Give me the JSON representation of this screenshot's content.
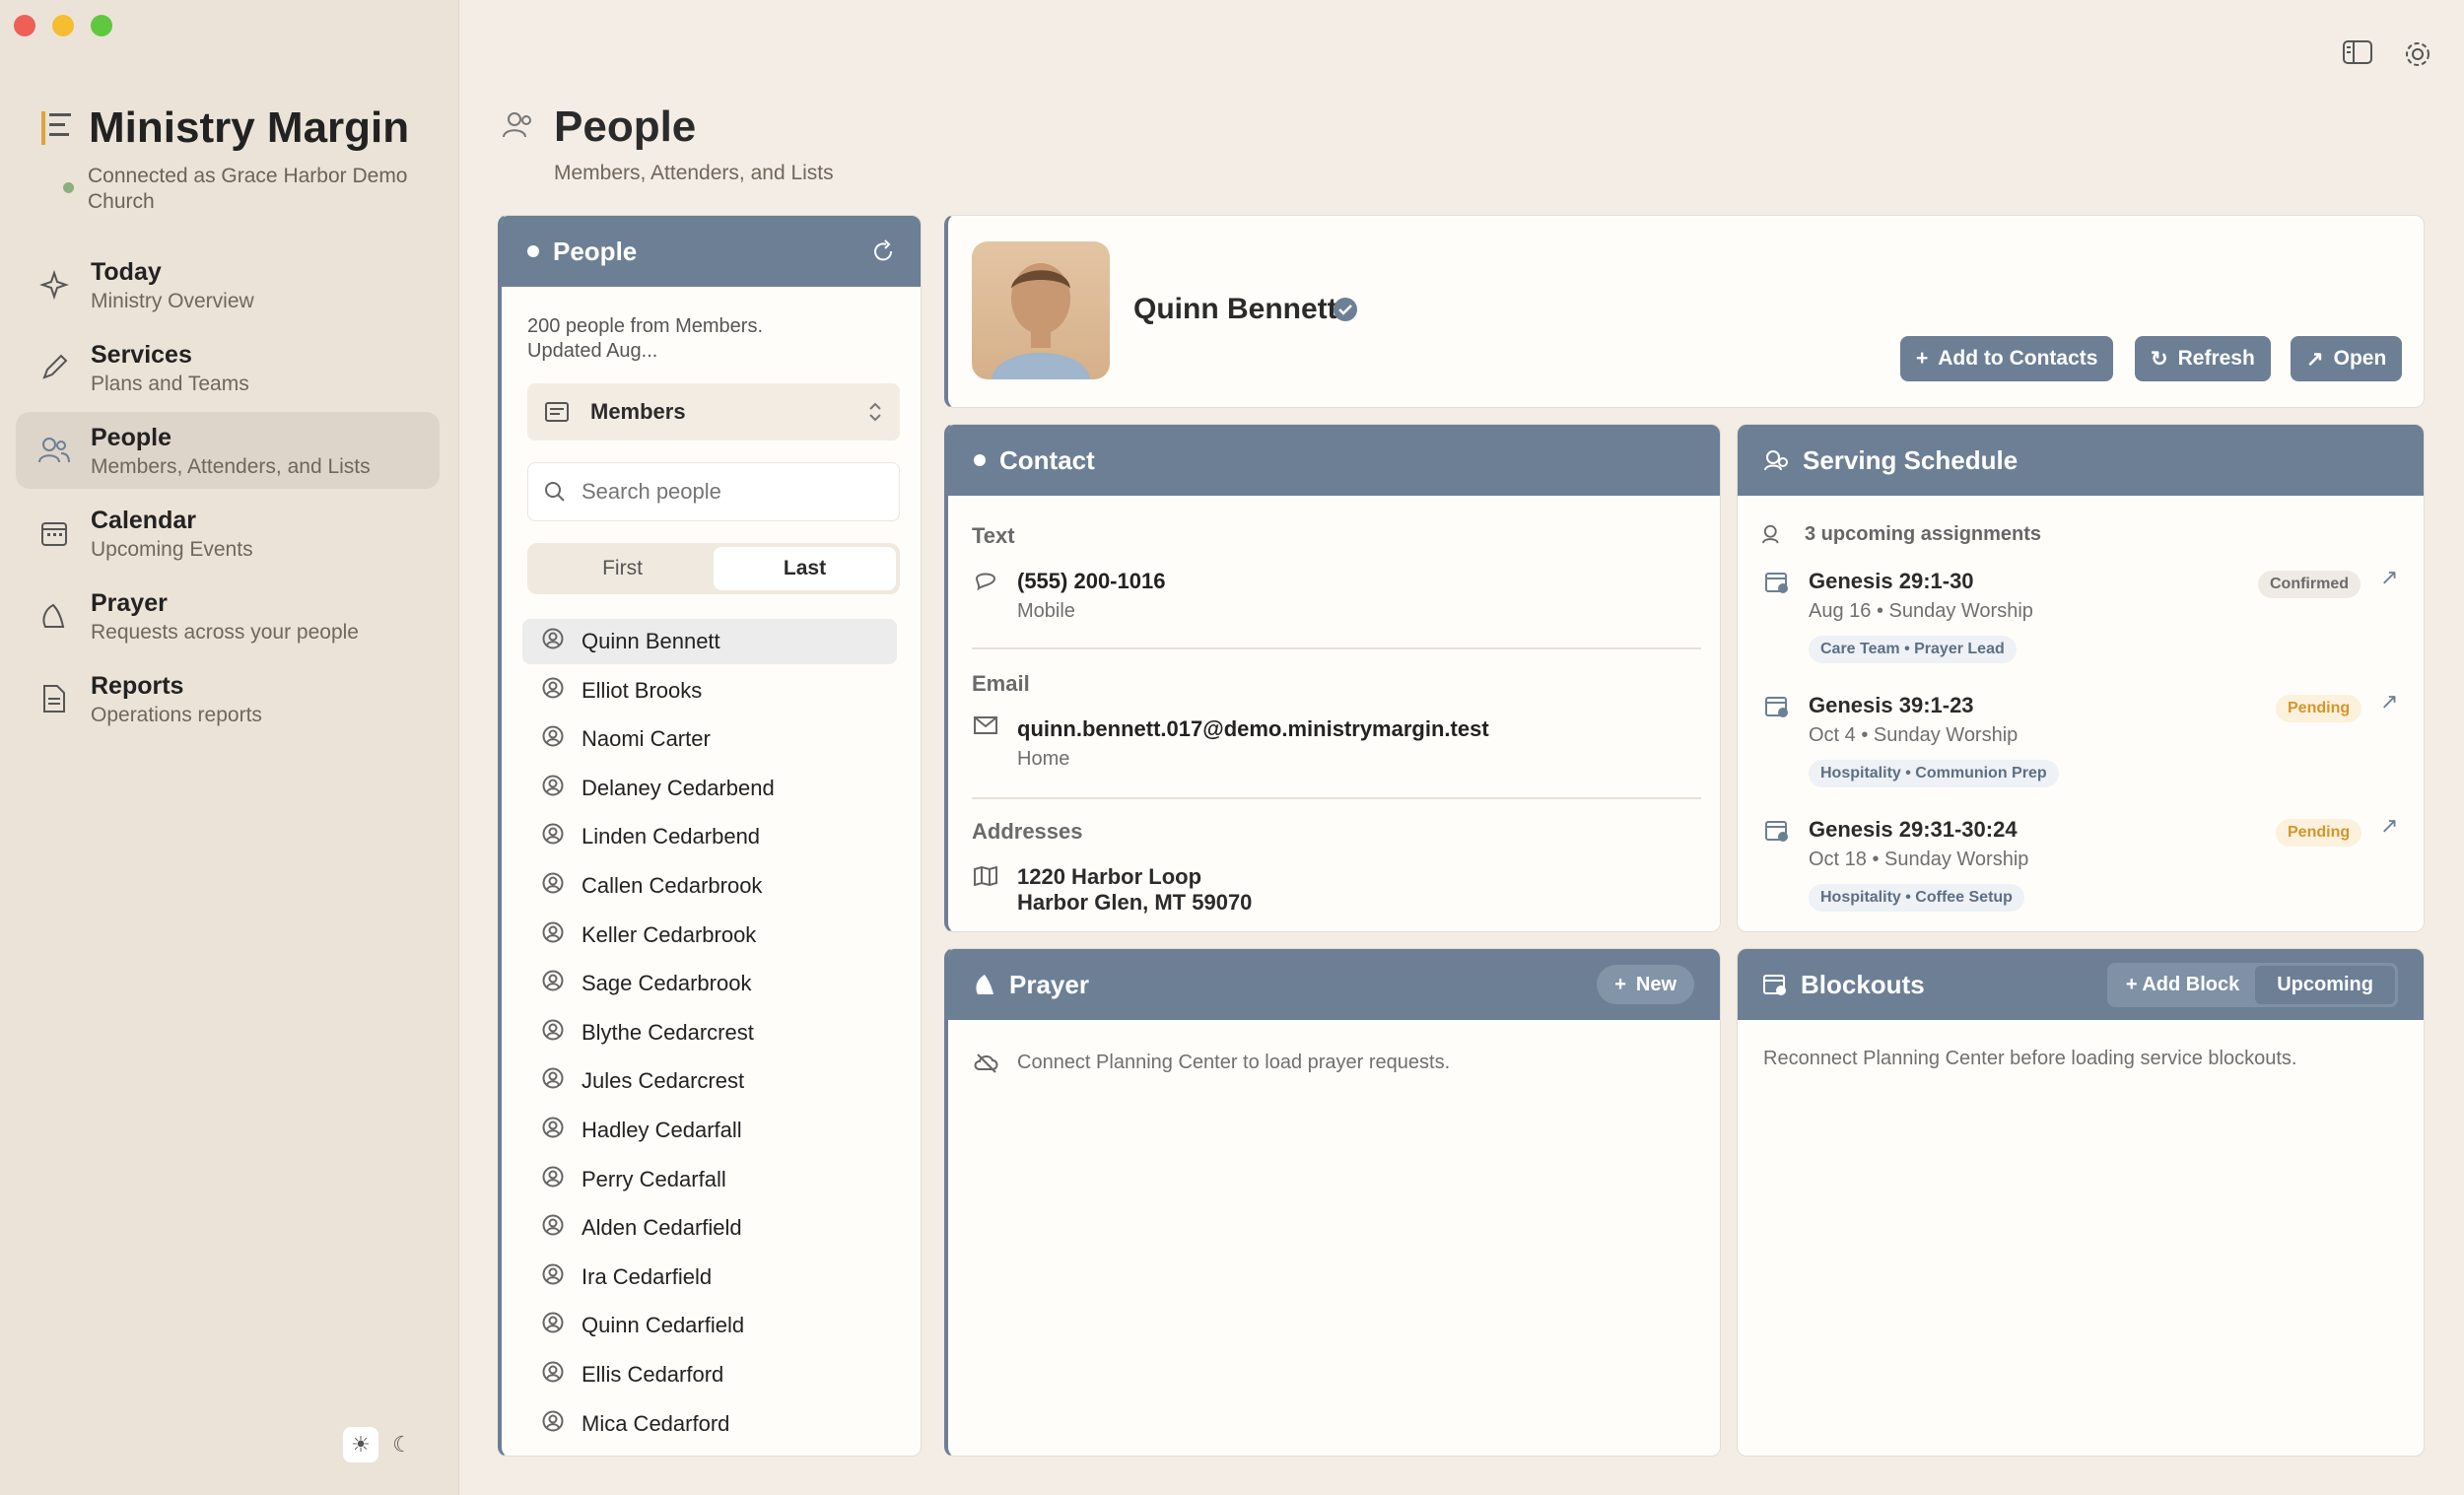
{
  "app": {
    "title": "Ministry Margin",
    "connection": "Connected as Grace Harbor Demo Church"
  },
  "nav": [
    {
      "title": "Today",
      "sub": "Ministry Overview",
      "icon": "sparkle-icon"
    },
    {
      "title": "Services",
      "sub": "Plans and Teams",
      "icon": "pen-icon"
    },
    {
      "title": "People",
      "sub": "Members, Attenders, and Lists",
      "icon": "people-icon"
    },
    {
      "title": "Calendar",
      "sub": "Upcoming Events",
      "icon": "calendar-icon"
    },
    {
      "title": "Prayer",
      "sub": "Requests across your people",
      "icon": "prayer-icon"
    },
    {
      "title": "Reports",
      "sub": "Operations reports",
      "icon": "document-icon"
    }
  ],
  "header": {
    "title": "People",
    "subtitle": "Members, Attenders, and Lists"
  },
  "list": {
    "title": "People",
    "summary": "200 people from Members. Updated Aug...",
    "dropdown": "Members",
    "search_placeholder": "Search people",
    "sort": [
      "First",
      "Last"
    ],
    "people": [
      "Quinn Bennett",
      "Elliot Brooks",
      "Naomi Carter",
      "Delaney Cedarbend",
      "Linden Cedarbend",
      "Callen Cedarbrook",
      "Keller Cedarbrook",
      "Sage Cedarbrook",
      "Blythe Cedarcrest",
      "Jules Cedarcrest",
      "Hadley Cedarfall",
      "Perry Cedarfall",
      "Alden Cedarfield",
      "Ira Cedarfield",
      "Quinn Cedarfield",
      "Ellis Cedarford",
      "Mica Cedarford"
    ]
  },
  "profile": {
    "name": "Quinn Bennett",
    "buttons": [
      "Add to Contacts",
      "Refresh",
      "Open"
    ]
  },
  "contact": {
    "title": "Contact",
    "text_label": "Text",
    "phone": "(555) 200-1016",
    "phone_type": "Mobile",
    "email_label": "Email",
    "email": "quinn.bennett.017@demo.ministrymargin.test",
    "email_type": "Home",
    "address_label": "Addresses",
    "address1": "1220 Harbor Loop",
    "address2": "Harbor Glen, MT 59070"
  },
  "schedule": {
    "title": "Serving Schedule",
    "count": "3 upcoming assignments",
    "items": [
      {
        "title": "Genesis 29:1-30",
        "when": "Aug 16 • Sunday Worship",
        "status": "Confirmed",
        "team": "Care Team • Prayer Lead"
      },
      {
        "title": "Genesis 39:1-23",
        "when": "Oct 4 • Sunday Worship",
        "status": "Pending",
        "team": "Hospitality • Communion Prep"
      },
      {
        "title": "Genesis 29:31-30:24",
        "when": "Oct 18 • Sunday Worship",
        "status": "Pending",
        "team": "Hospitality • Coffee Setup"
      }
    ]
  },
  "prayer": {
    "title": "Prayer",
    "new_label": "New",
    "message": "Connect Planning Center to load prayer requests."
  },
  "blockouts": {
    "title": "Blockouts",
    "add_label": "+ Add Block",
    "upcoming_label": "Upcoming",
    "message": "Reconnect Planning Center before loading service blockouts."
  },
  "colors": {
    "accent": "#6c7f95",
    "sidebar": "#ece3d8",
    "background": "#f3ede5"
  }
}
